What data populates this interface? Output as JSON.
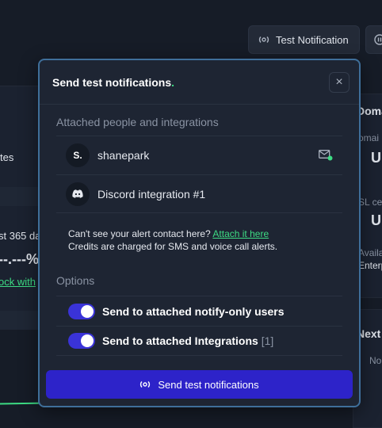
{
  "background": {
    "header_button": "Test Notification",
    "left": {
      "partial_label_1": "tes",
      "partial_label_2": "st 365 da",
      "partial_value": "--.---%",
      "partial_link": "ock with"
    },
    "right": {
      "partial_title": "Doma",
      "partial_sub_1": "omai",
      "partial_val_1": "U",
      "partial_sub_2": "SL ce",
      "partial_val_2": "U",
      "partial_sub_3": "Availa",
      "partial_sub_4": "Enterp",
      "partial_title_2": "Next",
      "partial_sub_5": "No"
    }
  },
  "modal": {
    "title": "Send test notifications",
    "title_dot": ".",
    "close_label": "×",
    "attached_label": "Attached people and integrations",
    "contacts": [
      {
        "initial": "S.",
        "name": "shanepark",
        "icon": "mail-verified-icon"
      },
      {
        "initial": "",
        "name": "Discord integration #1",
        "icon": "discord-icon"
      }
    ],
    "info_line1_prefix": "Can't see your alert contact here?",
    "info_link": "Attach it here",
    "info_line2": "Credits are charged for SMS and voice call alerts.",
    "options_label": "Options",
    "options": [
      {
        "label": "Send to attached notify-only users",
        "count": "",
        "enabled": true
      },
      {
        "label": "Send to attached Integrations",
        "count": "[1]",
        "enabled": true
      }
    ],
    "send_button": "Send test notifications"
  },
  "colors": {
    "accent_green": "#3ddc84",
    "primary_button": "#2d23c9",
    "toggle_on": "#3a33d8",
    "modal_border": "#3f6f9a"
  }
}
